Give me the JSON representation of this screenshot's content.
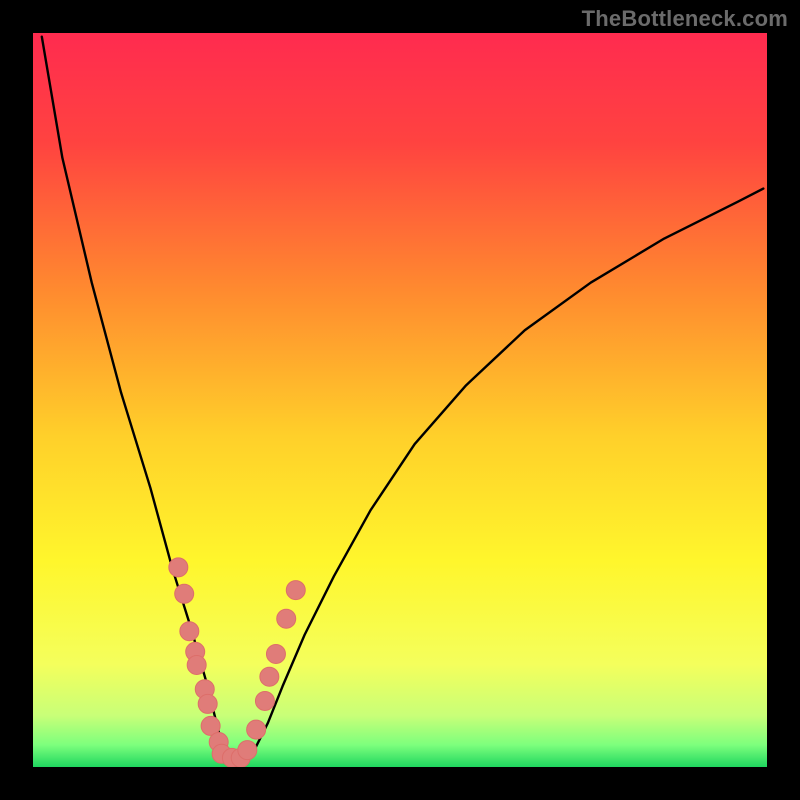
{
  "watermark": "TheBottleneck.com",
  "colors": {
    "frame": "#000000",
    "watermark": "#6b6b6b",
    "curve": "#000000",
    "marker_fill": "#e07c79",
    "marker_stroke": "#dd6e6a",
    "gradient_stops": [
      {
        "offset": 0.0,
        "color": "#ff2b4f"
      },
      {
        "offset": 0.15,
        "color": "#ff4340"
      },
      {
        "offset": 0.35,
        "color": "#ff8a2f"
      },
      {
        "offset": 0.55,
        "color": "#ffd02a"
      },
      {
        "offset": 0.72,
        "color": "#fff62c"
      },
      {
        "offset": 0.86,
        "color": "#f4ff5c"
      },
      {
        "offset": 0.93,
        "color": "#c8ff78"
      },
      {
        "offset": 0.97,
        "color": "#7dff7d"
      },
      {
        "offset": 1.0,
        "color": "#1fd65f"
      }
    ]
  },
  "chart_data": {
    "type": "line",
    "title": "",
    "xlabel": "",
    "ylabel": "",
    "xlim": [
      0,
      100
    ],
    "ylim": [
      0,
      100
    ],
    "notch_x": 27,
    "series": [
      {
        "name": "left-branch",
        "x": [
          1.2,
          4,
          8,
          12,
          16,
          19,
          21.5,
          23.5,
          25,
          26,
          27
        ],
        "y": [
          99.5,
          83,
          66,
          51,
          38,
          27,
          19,
          12,
          6,
          2,
          0.2
        ]
      },
      {
        "name": "right-branch",
        "x": [
          28.5,
          30,
          32,
          34,
          37,
          41,
          46,
          52,
          59,
          67,
          76,
          86,
          96,
          99.5
        ],
        "y": [
          0.2,
          2,
          6,
          11,
          18,
          26,
          35,
          44,
          52,
          59.5,
          66,
          72,
          77,
          78.8
        ]
      }
    ],
    "markers": {
      "name": "dots",
      "points": [
        {
          "x": 19.8,
          "y": 27.2
        },
        {
          "x": 20.6,
          "y": 23.6
        },
        {
          "x": 21.3,
          "y": 18.5
        },
        {
          "x": 22.1,
          "y": 15.7
        },
        {
          "x": 22.3,
          "y": 13.9
        },
        {
          "x": 23.4,
          "y": 10.6
        },
        {
          "x": 23.8,
          "y": 8.6
        },
        {
          "x": 24.2,
          "y": 5.6
        },
        {
          "x": 25.3,
          "y": 3.4
        },
        {
          "x": 25.7,
          "y": 1.8
        },
        {
          "x": 27.1,
          "y": 1.25
        },
        {
          "x": 28.3,
          "y": 1.25
        },
        {
          "x": 29.2,
          "y": 2.3
        },
        {
          "x": 30.4,
          "y": 5.1
        },
        {
          "x": 31.6,
          "y": 9.0
        },
        {
          "x": 32.2,
          "y": 12.3
        },
        {
          "x": 33.1,
          "y": 15.4
        },
        {
          "x": 34.5,
          "y": 20.2
        },
        {
          "x": 35.8,
          "y": 24.1
        }
      ]
    }
  }
}
